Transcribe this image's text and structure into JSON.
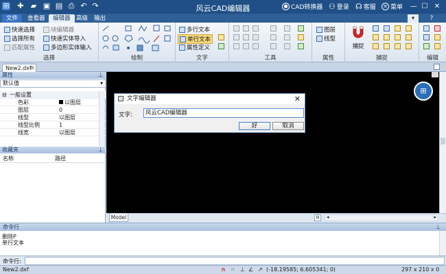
{
  "app": {
    "title": "风云CAD编辑器",
    "tools": [
      {
        "label": "CAD转换器",
        "icon": "record-icon"
      },
      {
        "label": "登录",
        "icon": "user-icon"
      },
      {
        "label": "客服",
        "icon": "headset-icon"
      },
      {
        "label": "菜单",
        "icon": "menu-icon"
      }
    ]
  },
  "tabs": [
    "文件",
    "查看器",
    "编辑器",
    "高级",
    "输出"
  ],
  "active_tab": "编辑器",
  "ribbon": {
    "select_group": {
      "label": "选择",
      "items": [
        "快速选择",
        "块编辑器",
        "选择所有",
        "快速实体导入",
        "匹配属性",
        "多边形实体输入"
      ]
    },
    "draw_group": {
      "label": "绘制"
    },
    "text_group": {
      "label": "文字",
      "items": [
        "多行文本",
        "单行文本",
        "属性定义"
      ]
    },
    "tools_group": {
      "label": "工具"
    },
    "props_group": {
      "label": "属性",
      "items": [
        "图层",
        "线型"
      ]
    },
    "snap_group": {
      "label": "捕捉",
      "big": "捕捉"
    },
    "edit_group": {
      "label": "编辑"
    }
  },
  "document": {
    "tab": "New2.dxf"
  },
  "properties": {
    "header": "属性",
    "selector": "默认值",
    "section": "一般设置",
    "rows": [
      {
        "k": "色彩",
        "v": "以图层"
      },
      {
        "k": "图层",
        "v": "0"
      },
      {
        "k": "线型",
        "v": "以图层"
      },
      {
        "k": "线型比例",
        "v": "1"
      },
      {
        "k": "线宽",
        "v": "以图层"
      }
    ]
  },
  "favorites": {
    "header": "收藏夹",
    "col_name": "名称",
    "col_path": "路径"
  },
  "canvas": {
    "tab": "Model"
  },
  "dialog": {
    "title": "文字编辑器",
    "label": "文字:",
    "value": "风云CAD编辑器",
    "ok": "好",
    "cancel": "取消"
  },
  "command": {
    "header": "命令行",
    "lines": [
      "删除P",
      "单行文本"
    ],
    "prompt": "命令行:"
  },
  "status": {
    "file": "New2.dxf",
    "coords": "(-18.19585; 6.605341; 0)",
    "size": "297 x 210 x 0"
  }
}
